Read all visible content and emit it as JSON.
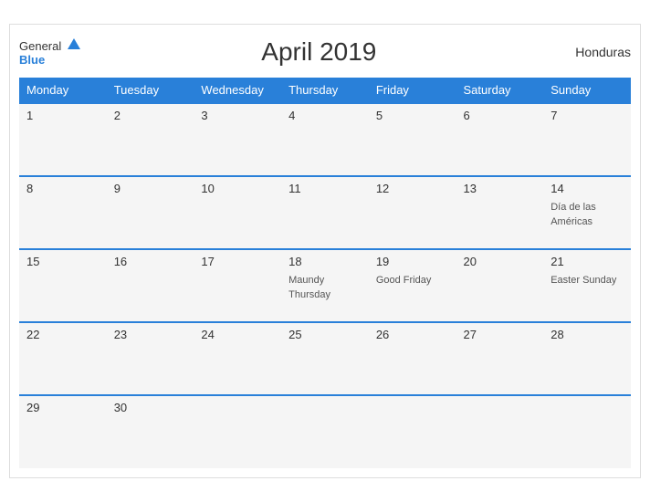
{
  "header": {
    "logo_general": "General",
    "logo_blue": "Blue",
    "title": "April 2019",
    "country": "Honduras"
  },
  "weekdays": [
    "Monday",
    "Tuesday",
    "Wednesday",
    "Thursday",
    "Friday",
    "Saturday",
    "Sunday"
  ],
  "weeks": [
    [
      {
        "day": "1",
        "event": ""
      },
      {
        "day": "2",
        "event": ""
      },
      {
        "day": "3",
        "event": ""
      },
      {
        "day": "4",
        "event": ""
      },
      {
        "day": "5",
        "event": ""
      },
      {
        "day": "6",
        "event": ""
      },
      {
        "day": "7",
        "event": ""
      }
    ],
    [
      {
        "day": "8",
        "event": ""
      },
      {
        "day": "9",
        "event": ""
      },
      {
        "day": "10",
        "event": ""
      },
      {
        "day": "11",
        "event": ""
      },
      {
        "day": "12",
        "event": ""
      },
      {
        "day": "13",
        "event": ""
      },
      {
        "day": "14",
        "event": "Día de las Américas"
      }
    ],
    [
      {
        "day": "15",
        "event": ""
      },
      {
        "day": "16",
        "event": ""
      },
      {
        "day": "17",
        "event": ""
      },
      {
        "day": "18",
        "event": "Maundy Thursday"
      },
      {
        "day": "19",
        "event": "Good Friday"
      },
      {
        "day": "20",
        "event": ""
      },
      {
        "day": "21",
        "event": "Easter Sunday"
      }
    ],
    [
      {
        "day": "22",
        "event": ""
      },
      {
        "day": "23",
        "event": ""
      },
      {
        "day": "24",
        "event": ""
      },
      {
        "day": "25",
        "event": ""
      },
      {
        "day": "26",
        "event": ""
      },
      {
        "day": "27",
        "event": ""
      },
      {
        "day": "28",
        "event": ""
      }
    ],
    [
      {
        "day": "29",
        "event": ""
      },
      {
        "day": "30",
        "event": ""
      },
      {
        "day": "",
        "event": ""
      },
      {
        "day": "",
        "event": ""
      },
      {
        "day": "",
        "event": ""
      },
      {
        "day": "",
        "event": ""
      },
      {
        "day": "",
        "event": ""
      }
    ]
  ]
}
